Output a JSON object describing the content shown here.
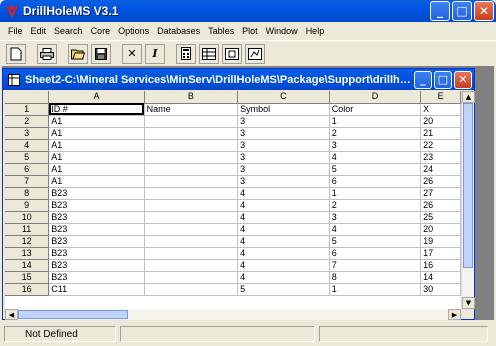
{
  "window": {
    "title": "DrillHoleMS V3.1"
  },
  "menu": [
    "File",
    "Edit",
    "Search",
    "Core",
    "Options",
    "Databases",
    "Tables",
    "Plot",
    "Window",
    "Help"
  ],
  "toolbar": {
    "new_icon": "new-document-icon",
    "print_icon": "printer-icon",
    "open_icon": "open-folder-icon",
    "save_icon": "save-disk-icon",
    "delete_icon": "x-delete-icon",
    "italic_icon": "italic-icon",
    "tool1_icon": "calculator-icon",
    "tool2_icon": "table-icon",
    "tool3_icon": "frame-icon",
    "tool4_icon": "chart-icon"
  },
  "child": {
    "title": "Sheet2-C:\\Mineral Services\\MinServ\\DrillHoleMS\\Package\\Support\\drillhole4..."
  },
  "grid": {
    "columns": [
      "A",
      "B",
      "C",
      "D",
      "E"
    ],
    "rows": [
      {
        "n": "1",
        "a": "ID #",
        "b": "Name",
        "c": "Symbol",
        "d": "Color",
        "e": "X"
      },
      {
        "n": "2",
        "a": "A1",
        "b": "",
        "c": "3",
        "d": "1",
        "e": "20"
      },
      {
        "n": "3",
        "a": "A1",
        "b": "",
        "c": "3",
        "d": "2",
        "e": "21"
      },
      {
        "n": "4",
        "a": "A1",
        "b": "",
        "c": "3",
        "d": "3",
        "e": "22"
      },
      {
        "n": "5",
        "a": "A1",
        "b": "",
        "c": "3",
        "d": "4",
        "e": "23"
      },
      {
        "n": "6",
        "a": "A1",
        "b": "",
        "c": "3",
        "d": "5",
        "e": "24"
      },
      {
        "n": "7",
        "a": "A1",
        "b": "",
        "c": "3",
        "d": "6",
        "e": "26"
      },
      {
        "n": "8",
        "a": "B23",
        "b": "",
        "c": "4",
        "d": "1",
        "e": "27"
      },
      {
        "n": "9",
        "a": "B23",
        "b": "",
        "c": "4",
        "d": "2",
        "e": "26"
      },
      {
        "n": "10",
        "a": "B23",
        "b": "",
        "c": "4",
        "d": "3",
        "e": "25"
      },
      {
        "n": "11",
        "a": "B23",
        "b": "",
        "c": "4",
        "d": "4",
        "e": "20"
      },
      {
        "n": "12",
        "a": "B23",
        "b": "",
        "c": "4",
        "d": "5",
        "e": "19"
      },
      {
        "n": "13",
        "a": "B23",
        "b": "",
        "c": "4",
        "d": "6",
        "e": "17"
      },
      {
        "n": "14",
        "a": "B23",
        "b": "",
        "c": "4",
        "d": "7",
        "e": "16"
      },
      {
        "n": "15",
        "a": "B23",
        "b": "",
        "c": "4",
        "d": "8",
        "e": "14"
      },
      {
        "n": "16",
        "a": "C11",
        "b": "",
        "c": "5",
        "d": "1",
        "e": "30"
      }
    ]
  },
  "status": {
    "pane1": "Not Defined",
    "pane2": "",
    "pane3": ""
  }
}
